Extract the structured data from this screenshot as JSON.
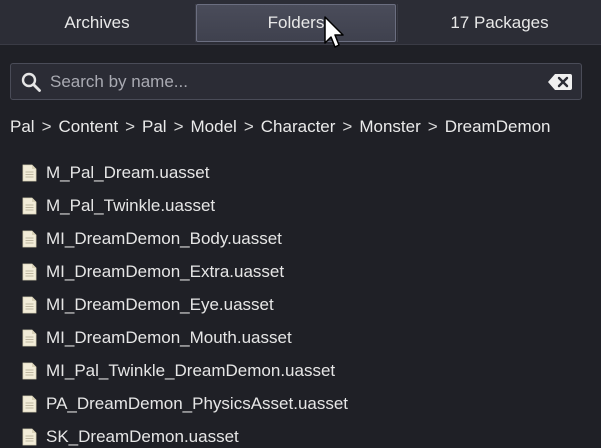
{
  "tabs": [
    {
      "label": "Archives"
    },
    {
      "label": "Folders",
      "active": true
    },
    {
      "label": "17 Packages"
    }
  ],
  "search": {
    "placeholder": "Search by name...",
    "value": ""
  },
  "breadcrumb": [
    "Pal",
    "Content",
    "Pal",
    "Model",
    "Character",
    "Monster",
    "DreamDemon"
  ],
  "breadcrumb_separator": ">",
  "files": [
    {
      "name": "M_Pal_Dream.uasset"
    },
    {
      "name": "M_Pal_Twinkle.uasset"
    },
    {
      "name": "MI_DreamDemon_Body.uasset"
    },
    {
      "name": "MI_DreamDemon_Extra.uasset"
    },
    {
      "name": "MI_DreamDemon_Eye.uasset"
    },
    {
      "name": "MI_DreamDemon_Mouth.uasset"
    },
    {
      "name": "MI_Pal_Twinkle_DreamDemon.uasset"
    },
    {
      "name": "PA_DreamDemon_PhysicsAsset.uasset"
    },
    {
      "name": "SK_DreamDemon.uasset"
    }
  ],
  "icons": {
    "search": "search-icon",
    "clear": "clear-icon",
    "file": "file-icon",
    "cursor": "mouse-cursor-icon"
  },
  "colors": {
    "background": "#1f2026",
    "tab_bar": "#2c2d36",
    "active_tab": "#454755",
    "text": "#e6e6e6",
    "placeholder": "#a9aab2"
  }
}
